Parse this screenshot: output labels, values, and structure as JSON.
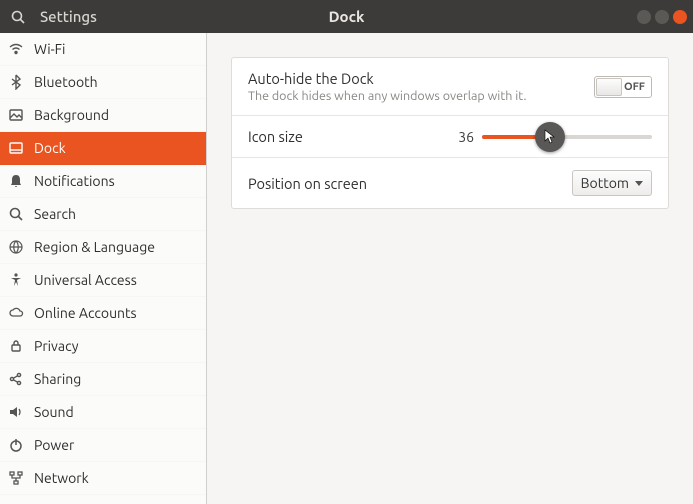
{
  "titlebar": {
    "left_title": "Settings",
    "center_title": "Dock"
  },
  "sidebar": {
    "items": [
      {
        "label": "Wi-Fi"
      },
      {
        "label": "Bluetooth"
      },
      {
        "label": "Background"
      },
      {
        "label": "Dock"
      },
      {
        "label": "Notifications"
      },
      {
        "label": "Search"
      },
      {
        "label": "Region & Language"
      },
      {
        "label": "Universal Access"
      },
      {
        "label": "Online Accounts"
      },
      {
        "label": "Privacy"
      },
      {
        "label": "Sharing"
      },
      {
        "label": "Sound"
      },
      {
        "label": "Power"
      },
      {
        "label": "Network"
      }
    ],
    "active_index": 3
  },
  "dock": {
    "autohide": {
      "title": "Auto-hide the Dock",
      "subtitle": "The dock hides when any windows overlap with it.",
      "state_label": "OFF"
    },
    "iconsize": {
      "label": "Icon size",
      "value": "36"
    },
    "position": {
      "label": "Position on screen",
      "value": "Bottom"
    }
  },
  "colors": {
    "accent": "#e95420"
  }
}
